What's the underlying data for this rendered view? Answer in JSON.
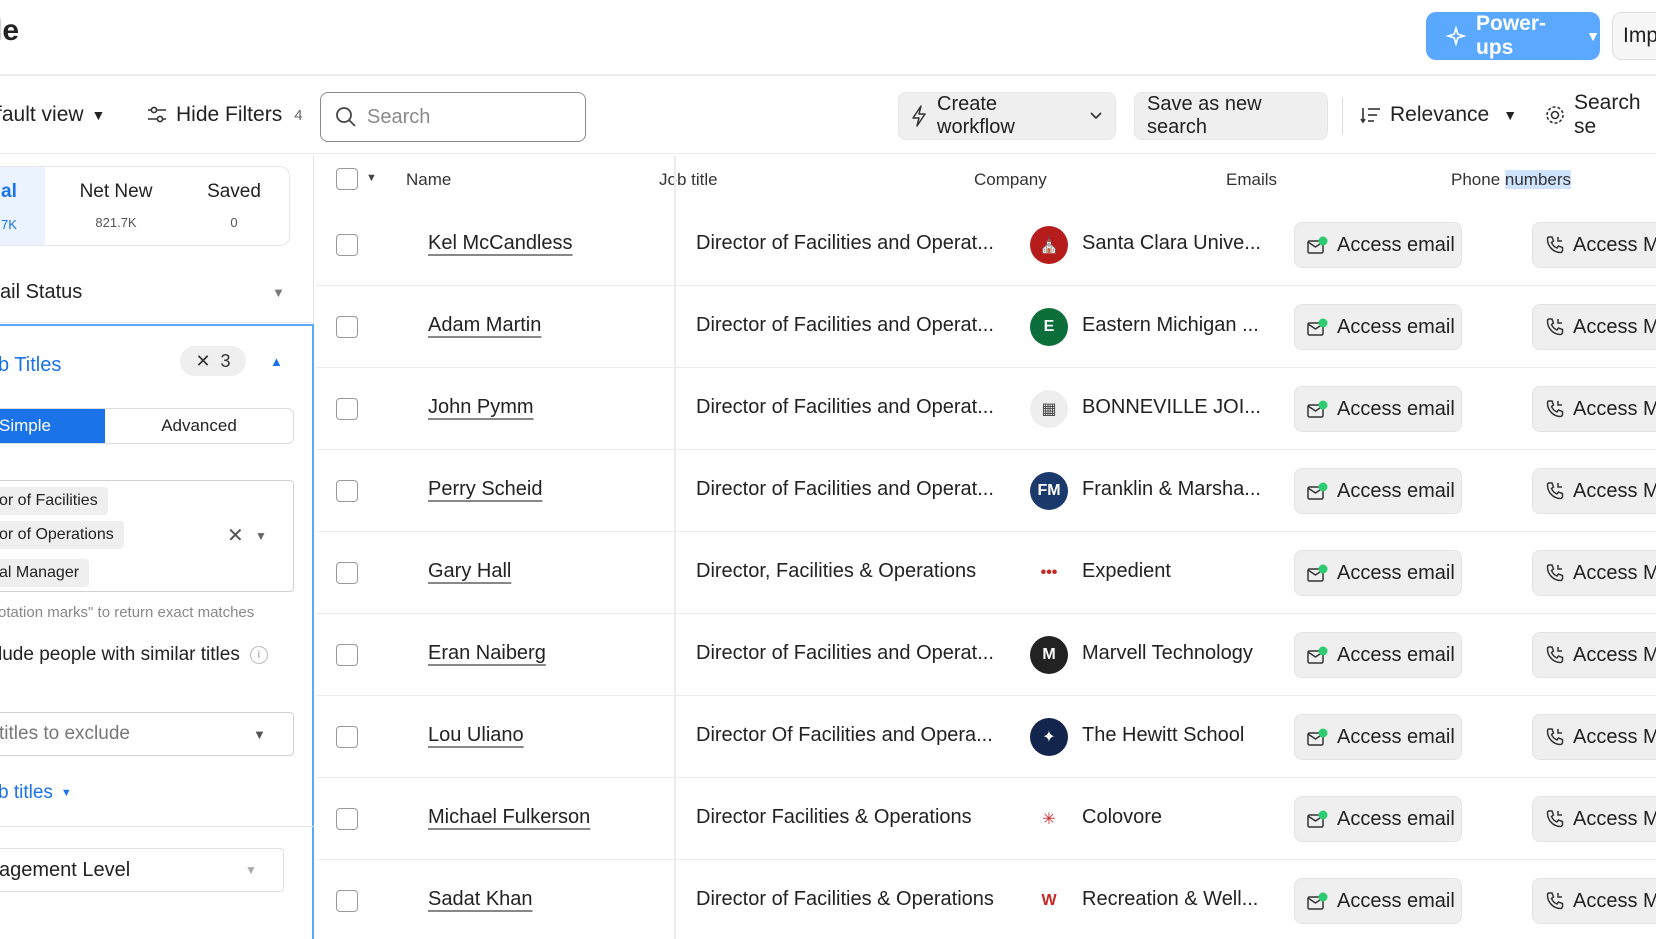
{
  "header": {
    "title": "le",
    "powerups_label": "Power-ups",
    "import_label": "Imp",
    "accent_color": "#5aa8ff"
  },
  "toolbar": {
    "view_label": "fault view",
    "hide_filters_label": "Hide Filters",
    "hide_filters_count": "4",
    "search_placeholder": "Search",
    "create_workflow_label": "Create workflow",
    "save_search_label": "Save as new search",
    "sort_label": "Relevance",
    "search_settings_label": "Search se"
  },
  "panel": {
    "tabs": {
      "total_label": "al",
      "total_value": "7K",
      "net_new_label": "Net New",
      "net_new_value": "821.7K",
      "saved_label": "Saved",
      "saved_value": "0"
    },
    "email_status_label": "ail Status",
    "job_titles": {
      "header": "b Titles",
      "chip_count": "3",
      "simple_label": "Simple",
      "advanced_label": "Advanced",
      "selected": [
        "or of Facilities",
        "or of Operations",
        "al Manager"
      ],
      "hint": "otation marks\" to return exact matches",
      "similar_label": "lude people with similar titles",
      "exclude_placeholder": "titles to exclude",
      "link_label": "b titles"
    },
    "management_label": "agement Level"
  },
  "table": {
    "columns": [
      "Name",
      "Job title",
      "Company",
      "Emails"
    ],
    "phone_col_prefix": "Phone ",
    "phone_col_highlight": "numbers",
    "email_action": "Access email",
    "phone_action": "Access M",
    "rows": [
      {
        "name": "Kel McCandless",
        "job": "Director of Facilities and Operat...",
        "company": "Santa Clara Unive...",
        "logo_text": "⛪",
        "logo_color": "#b71c1c"
      },
      {
        "name": "Adam Martin",
        "job": "Director of Facilities and Operat...",
        "company": "Eastern Michigan ...",
        "logo_text": "E",
        "logo_color": "#0b6e3b"
      },
      {
        "name": "John Pymm",
        "job": "Director of Facilities and Operat...",
        "company": "BONNEVILLE JOI...",
        "logo_text": "▦",
        "logo_color": "#eeeeee"
      },
      {
        "name": "Perry Scheid",
        "job": "Director of Facilities and Operat...",
        "company": "Franklin & Marsha...",
        "logo_text": "FM",
        "logo_color": "#1b3a6b"
      },
      {
        "name": "Gary Hall",
        "job": "Director, Facilities & Operations",
        "company": "Expedient",
        "logo_text": "•••",
        "logo_color": "#ffffff"
      },
      {
        "name": "Eran Naiberg",
        "job": "Director of Facilities and Operat...",
        "company": "Marvell Technology",
        "logo_text": "M",
        "logo_color": "#222222"
      },
      {
        "name": "Lou Uliano",
        "job": "Director Of Facilities and Opera...",
        "company": "The Hewitt School",
        "logo_text": "✦",
        "logo_color": "#13254d"
      },
      {
        "name": "Michael Fulkerson",
        "job": "Director Facilities & Operations",
        "company": "Colovore",
        "logo_text": "✳",
        "logo_color": "#ffffff"
      },
      {
        "name": "Sadat Khan",
        "job": "Director of Facilities & Operations",
        "company": "Recreation & Well...",
        "logo_text": "W",
        "logo_color": "#ffffff"
      }
    ]
  }
}
